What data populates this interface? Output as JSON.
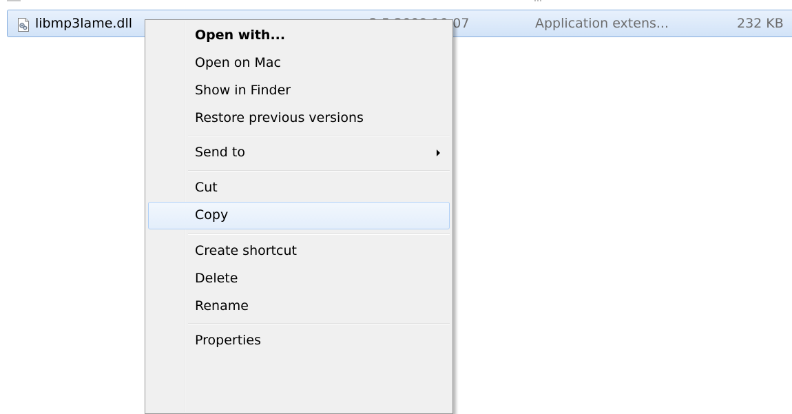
{
  "file_row": {
    "name": "libmp3lame.dll",
    "date_modified": "2.5.2009 10:07",
    "type": "Application extens...",
    "size": "232 KB",
    "icon": "dll-file-icon"
  },
  "context_menu": {
    "items": [
      {
        "label": "Open with...",
        "bold": true
      },
      {
        "label": "Open on Mac"
      },
      {
        "label": "Show in Finder"
      },
      {
        "label": "Restore previous versions"
      },
      {
        "label": "Send to",
        "submenu": true,
        "arrow_icon": "chevron-right-icon"
      },
      {
        "label": "Cut"
      },
      {
        "label": "Copy",
        "highlighted": true
      },
      {
        "label": "Create shortcut"
      },
      {
        "label": "Delete"
      },
      {
        "label": "Rename"
      },
      {
        "label": "Properties"
      }
    ]
  },
  "colors": {
    "selection_border": "#84acdd",
    "selection_fill": "#d9e8fb",
    "menu_background": "#f0f0f0",
    "menu_border": "#979797",
    "hover_border": "#aecff7",
    "secondary_text": "#6d6d6d"
  }
}
